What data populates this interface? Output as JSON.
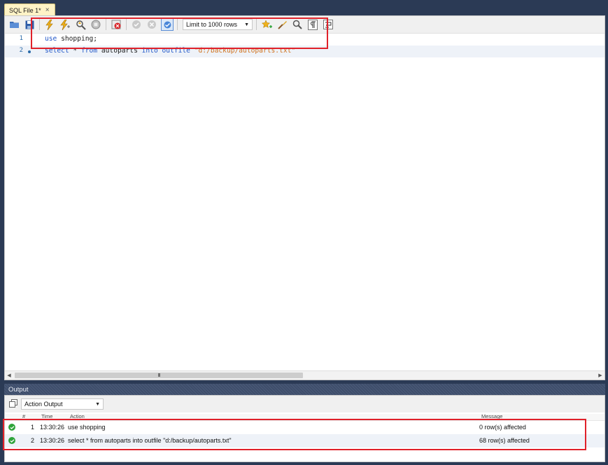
{
  "tab": {
    "label": "SQL File 1*",
    "close": "×"
  },
  "toolbar": {
    "limit_value": "Limit to 1000 rows",
    "icons": [
      "open-folder-icon",
      "save-icon",
      "execute-icon",
      "execute-current-icon",
      "explain-icon",
      "stop-icon",
      "toggle-error-icon",
      "commit-icon",
      "rollback-icon",
      "autocommit-icon",
      "bookmark-icon",
      "beautify-icon",
      "find-icon",
      "invisible-chars-icon",
      "wrap-icon"
    ]
  },
  "editor": {
    "lines": [
      {
        "number": "1",
        "tokens": [
          {
            "t": "use",
            "c": "kw"
          },
          {
            "t": " shopping;",
            "c": ""
          }
        ]
      },
      {
        "number": "2",
        "tokens": [
          {
            "t": "select",
            "c": "kw"
          },
          {
            "t": " * ",
            "c": ""
          },
          {
            "t": "from",
            "c": "kw"
          },
          {
            "t": " autoparts ",
            "c": ""
          },
          {
            "t": "into",
            "c": "kw"
          },
          {
            "t": " ",
            "c": ""
          },
          {
            "t": "outfile",
            "c": "kw"
          },
          {
            "t": " ",
            "c": ""
          },
          {
            "t": "\"d:/backup/autoparts.txt\"",
            "c": "str"
          }
        ]
      }
    ]
  },
  "scrollbar": {
    "thumb_grip": "III"
  },
  "output": {
    "title": "Output",
    "mode": "Action Output",
    "columns": {
      "num": "#",
      "time": "Time",
      "action": "Action",
      "message": "Message"
    },
    "rows": [
      {
        "num": "1",
        "time": "13:30:26",
        "action": "use shopping",
        "message": "0 row(s) affected"
      },
      {
        "num": "2",
        "time": "13:30:26",
        "action": "select * from autoparts into outfile \"d:/backup/autoparts.txt\"",
        "message": "68 row(s) affected"
      }
    ]
  },
  "colors": {
    "frame": "#2b3a55",
    "keyword": "#2056c8",
    "string": "#d0711d",
    "highlight": "#e0212a",
    "ok": "#2fa43a"
  }
}
